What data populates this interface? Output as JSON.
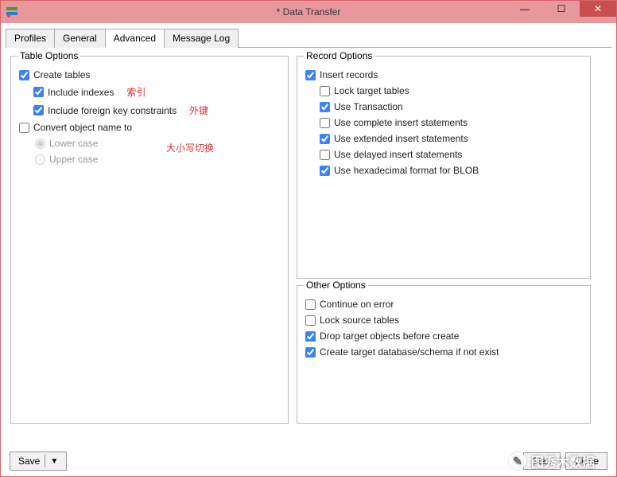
{
  "window": {
    "title": "* Data Transfer"
  },
  "tabs": {
    "profiles": "Profiles",
    "general": "General",
    "advanced": "Advanced",
    "message_log": "Message Log"
  },
  "table_options": {
    "legend": "Table Options",
    "create_tables": "Create tables",
    "include_indexes": "Include indexes",
    "include_fk": "Include foreign key constraints",
    "convert_name": "Convert object name to",
    "lower_case": "Lower case",
    "upper_case": "Upper case"
  },
  "record_options": {
    "legend": "Record Options",
    "insert_records": "Insert records",
    "lock_target_tables": "Lock target tables",
    "use_transaction": "Use Transaction",
    "use_complete_insert": "Use complete insert statements",
    "use_extended_insert": "Use extended insert statements",
    "use_delayed_insert": "Use delayed insert statements",
    "use_hex_blob": "Use hexadecimal format for BLOB"
  },
  "other_options": {
    "legend": "Other Options",
    "continue_on_error": "Continue on error",
    "lock_source_tables": "Lock source tables",
    "drop_target": "Drop target objects before create",
    "create_target_db": "Create target database/schema if not exist"
  },
  "annotations": {
    "indexes": "索引",
    "fk": "外键",
    "case_switch": "大小写切换"
  },
  "footer": {
    "save": "Save",
    "start": "Start",
    "close": "Close"
  },
  "watermark": "图秀木数据"
}
